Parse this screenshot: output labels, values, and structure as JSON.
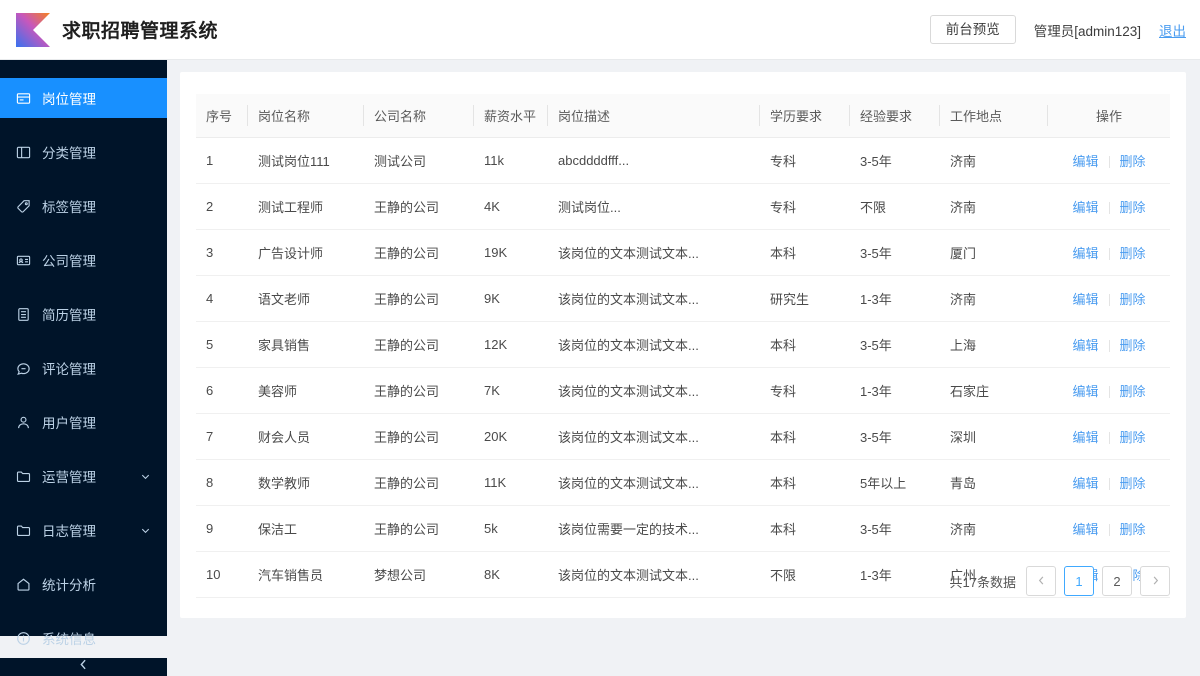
{
  "header": {
    "logo_icon": "kotlin-k-logo",
    "title": "求职招聘管理系统",
    "preview_button": "前台预览",
    "admin_label": "管理员[admin123]",
    "logout_label": "退出",
    "accent_color": "#1890ff",
    "link_color": "#4a9cf0"
  },
  "sidebar": {
    "background_color": "#001429",
    "active_color": "#1890ff",
    "collapse_icon": "chevron-left-icon",
    "items": [
      {
        "label": "岗位管理",
        "icon": "window-panel-icon",
        "active": true,
        "expandable": false
      },
      {
        "label": "分类管理",
        "icon": "layout-columns-icon",
        "active": false,
        "expandable": false
      },
      {
        "label": "标签管理",
        "icon": "tag-icon",
        "active": false,
        "expandable": false
      },
      {
        "label": "公司管理",
        "icon": "id-card-icon",
        "active": false,
        "expandable": false
      },
      {
        "label": "简历管理",
        "icon": "document-lines-icon",
        "active": false,
        "expandable": false
      },
      {
        "label": "评论管理",
        "icon": "comment-icon",
        "active": false,
        "expandable": false
      },
      {
        "label": "用户管理",
        "icon": "user-icon",
        "active": false,
        "expandable": false
      },
      {
        "label": "运营管理",
        "icon": "folder-icon",
        "active": false,
        "expandable": true
      },
      {
        "label": "日志管理",
        "icon": "folder-icon",
        "active": false,
        "expandable": true
      },
      {
        "label": "统计分析",
        "icon": "home-icon",
        "active": false,
        "expandable": false
      },
      {
        "label": "系统信息",
        "icon": "info-circle-icon",
        "active": false,
        "expandable": false
      }
    ]
  },
  "table": {
    "columns": [
      "序号",
      "岗位名称",
      "公司名称",
      "薪资水平",
      "岗位描述",
      "学历要求",
      "经验要求",
      "工作地点",
      "操作"
    ],
    "actions": {
      "edit": "编辑",
      "delete": "删除"
    },
    "rows": [
      {
        "idx": "1",
        "name": "测试岗位111",
        "company": "测试公司",
        "salary": "11k",
        "desc": "abcddddfff...",
        "edu": "专科",
        "exp": "3-5年",
        "loc": "济南"
      },
      {
        "idx": "2",
        "name": "测试工程师",
        "company": "王静的公司",
        "salary": "4K",
        "desc": "测试岗位...",
        "edu": "专科",
        "exp": "不限",
        "loc": "济南"
      },
      {
        "idx": "3",
        "name": "广告设计师",
        "company": "王静的公司",
        "salary": "19K",
        "desc": "该岗位的文本测试文本...",
        "edu": "本科",
        "exp": "3-5年",
        "loc": "厦门"
      },
      {
        "idx": "4",
        "name": "语文老师",
        "company": "王静的公司",
        "salary": "9K",
        "desc": "该岗位的文本测试文本...",
        "edu": "研究生",
        "exp": "1-3年",
        "loc": "济南"
      },
      {
        "idx": "5",
        "name": "家具销售",
        "company": "王静的公司",
        "salary": "12K",
        "desc": "该岗位的文本测试文本...",
        "edu": "本科",
        "exp": "3-5年",
        "loc": "上海"
      },
      {
        "idx": "6",
        "name": "美容师",
        "company": "王静的公司",
        "salary": "7K",
        "desc": "该岗位的文本测试文本...",
        "edu": "专科",
        "exp": "1-3年",
        "loc": "石家庄"
      },
      {
        "idx": "7",
        "name": "财会人员",
        "company": "王静的公司",
        "salary": "20K",
        "desc": "该岗位的文本测试文本...",
        "edu": "本科",
        "exp": "3-5年",
        "loc": "深圳"
      },
      {
        "idx": "8",
        "name": "数学教师",
        "company": "王静的公司",
        "salary": "11K",
        "desc": "该岗位的文本测试文本...",
        "edu": "本科",
        "exp": "5年以上",
        "loc": "青岛"
      },
      {
        "idx": "9",
        "name": "保洁工",
        "company": "王静的公司",
        "salary": "5k",
        "desc": "该岗位需要一定的技术...",
        "edu": "本科",
        "exp": "3-5年",
        "loc": "济南"
      },
      {
        "idx": "10",
        "name": "汽车销售员",
        "company": "梦想公司",
        "salary": "8K",
        "desc": "该岗位的文本测试文本...",
        "edu": "不限",
        "exp": "1-3年",
        "loc": "广州"
      }
    ]
  },
  "pagination": {
    "total_text": "共17条数据",
    "prev_icon": "chevron-left-icon",
    "next_icon": "chevron-right-icon",
    "pages": [
      "1",
      "2"
    ],
    "current_page": "1"
  }
}
